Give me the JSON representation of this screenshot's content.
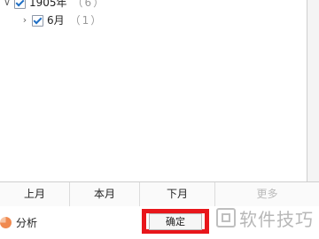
{
  "tree": {
    "items": [
      {
        "label": "1905年",
        "count": "（6）",
        "expanded": true,
        "checked": true,
        "icon": "chevron-down-icon"
      },
      {
        "label": "6月",
        "count": "（1）",
        "expanded": false,
        "checked": true,
        "icon": "chevron-right-icon"
      }
    ]
  },
  "month_bar": {
    "prev_month": "上月",
    "this_month": "本月",
    "next_month": "下月",
    "more": "更多"
  },
  "footer": {
    "analyze_label": "分析",
    "confirm_label": "确定"
  },
  "watermark": {
    "text": "软件技巧"
  },
  "colors": {
    "highlight_border": "#e8161b",
    "checkbox_check": "#1f6fc5",
    "pie_icon": "#f08a50"
  }
}
